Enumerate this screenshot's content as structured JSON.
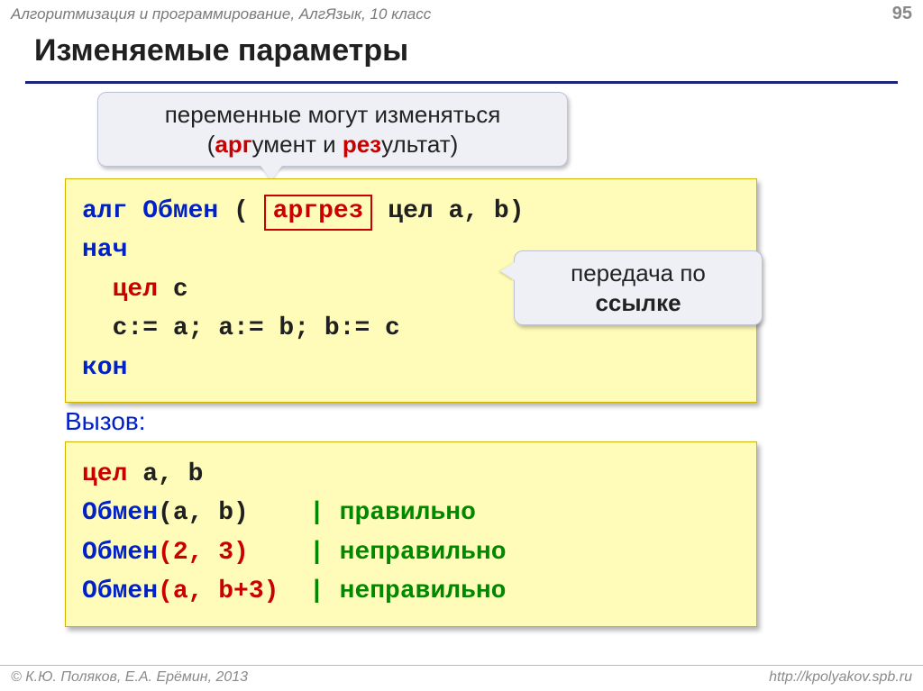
{
  "header": {
    "breadcrumb": "Алгоритмизация и программирование, АлгЯзык, 10 класс",
    "page": "95"
  },
  "title": "Изменяемые параметры",
  "callout_top": {
    "line1": "переменные могут изменяться",
    "pre": "(",
    "h1": "арг",
    "mid1": "умент и ",
    "h2": "рез",
    "mid2": "ультат)",
    "post": ""
  },
  "callout_right": {
    "line1": "передача по",
    "line2": "ссылке"
  },
  "code1": {
    "l1_alg": "алг",
    "l1_name": " Обмен ",
    "l1_open": "( ",
    "l1_keyword": "аргрез",
    "l1_rest": " цел a, b)",
    "l2": "нач",
    "l3_type": "цел",
    "l3_rest": " c",
    "l4": "  c:= a; a:= b; b:= c",
    "l5": "кон"
  },
  "call_label": "Вызов:",
  "code2": {
    "l1_type": "цел",
    "l1_rest": " a, b",
    "l2_fn": "Обмен",
    "l2_args": "(a, b)",
    "l2_pad": "    ",
    "l2_cmt": "| правильно",
    "l3_fn": "Обмен",
    "l3_args": "(2, 3)",
    "l3_pad": "    ",
    "l3_cmt": "| неправильно",
    "l4_fn": "Обмен",
    "l4_args": "(a, b+3)",
    "l4_pad": "  ",
    "l4_cmt": "| неправильно"
  },
  "footer": {
    "credit": "© К.Ю. Поляков, Е.А. Ерёмин, 2013",
    "url": "http://kpolyakov.spb.ru"
  }
}
